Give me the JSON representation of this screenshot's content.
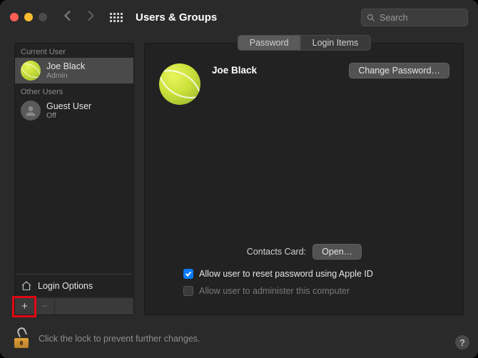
{
  "window": {
    "title": "Users & Groups",
    "search_placeholder": "Search"
  },
  "sidebar": {
    "current_label": "Current User",
    "other_label": "Other Users",
    "current_user": {
      "name": "Joe Black",
      "role": "Admin"
    },
    "other_users": [
      {
        "name": "Guest User",
        "role": "Off"
      }
    ],
    "login_options": "Login Options",
    "add_symbol": "+",
    "remove_symbol": "−"
  },
  "tabs": {
    "password": "Password",
    "login_items": "Login Items"
  },
  "main": {
    "user_name": "Joe Black",
    "change_password": "Change Password…",
    "contacts_label": "Contacts Card:",
    "open_button": "Open…",
    "allow_reset_apple_id": "Allow user to reset password using Apple ID",
    "allow_administer": "Allow user to administer this computer"
  },
  "footer": {
    "lock_text": "Click the lock to prevent further changes.",
    "help": "?"
  }
}
